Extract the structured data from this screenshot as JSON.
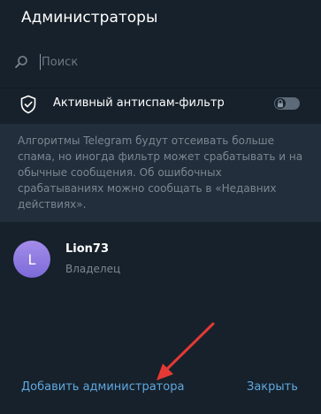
{
  "dialog": {
    "title": "Администраторы"
  },
  "search": {
    "placeholder": "Поиск",
    "value": ""
  },
  "antispam": {
    "label": "Активный антиспам-фильтр",
    "enabled": false
  },
  "info": {
    "text": "Алгоритмы Telegram будут отсеивать больше спама, но иногда фильтр может срабатывать и на обычные сообщения. Об ошибочных срабатываниях можно сообщать в «Недавних действиях»."
  },
  "admins": [
    {
      "initial": "L",
      "name": "Lion73",
      "role": "Владелец"
    }
  ],
  "footer": {
    "add_label": "Добавить администратора",
    "close_label": "Закрыть"
  },
  "colors": {
    "background": "#17212b",
    "info_background": "#232e3c",
    "accent": "#5fa8e0",
    "muted": "#7b8792",
    "avatar": "#8d79e0",
    "annotation_arrow": "#e53935"
  },
  "icons": {
    "search": "search-icon",
    "shield": "shield-check-icon",
    "toggle_lock": "lock-icon"
  }
}
